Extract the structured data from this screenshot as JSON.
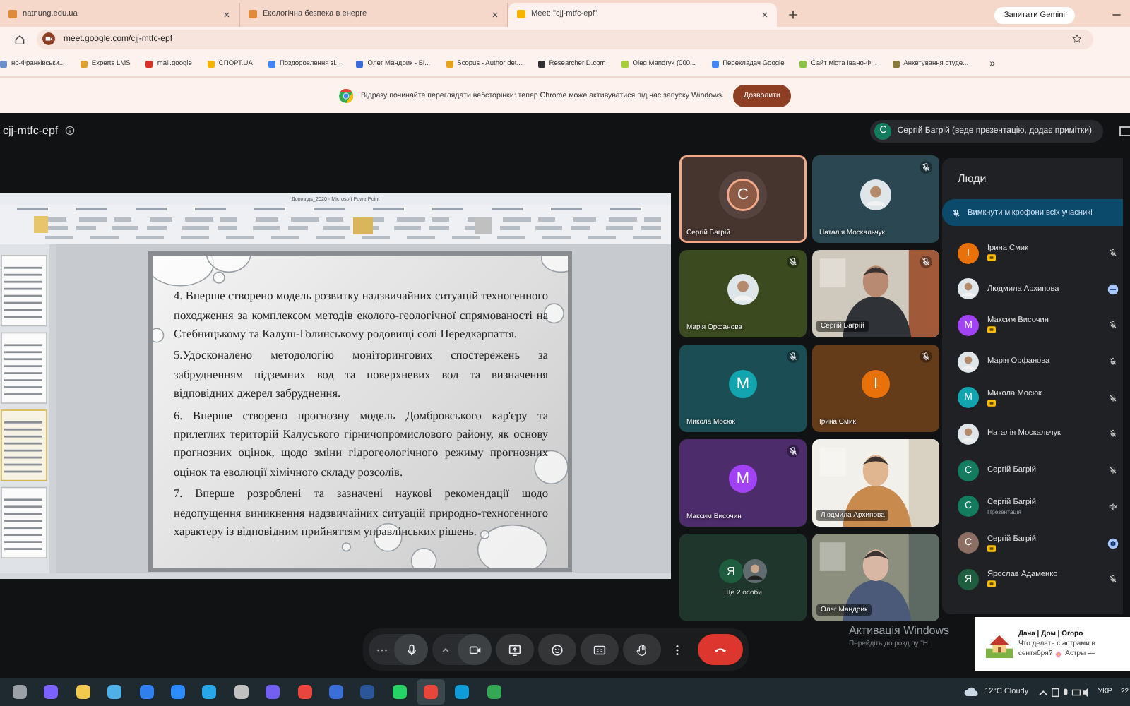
{
  "browser": {
    "tabs": [
      {
        "title": "natnung.edu.ua",
        "selected": false
      },
      {
        "title": "Екологічна безпека в енерге",
        "selected": false
      },
      {
        "title": "Meet: \"cjj-mtfc-epf\"",
        "selected": true
      }
    ],
    "gemini_button": "Запитати Gemini",
    "address": "meet.google.com/cjj-mtfc-epf",
    "bookmarks": [
      "но-Франківськи...",
      "Experts LMS",
      "mail.google",
      "СПОРТ.UA",
      "Поздоровлення зі...",
      "Олег Мандрик - Бі...",
      "Scopus - Author det...",
      "ResearcherID.com",
      "Oleg Mandryk (000...",
      "Перекладач Google",
      "Сайт міста Івано-Ф...",
      "Анкетування студе..."
    ],
    "bookmarks_more": "»",
    "infobar": {
      "message": "Відразу починайте переглядати вебсторінки: тепер Chrome може активуватися під час запуску Windows.",
      "button": "Дозволити"
    }
  },
  "meeting": {
    "code": "cjj-mtfc-epf",
    "presenter": {
      "letter": "С",
      "text": "Сергій Багрій (веде презентацію, додає примітки)"
    }
  },
  "presentation": {
    "window_title": "Доповідь_2020 - Microsoft PowerPoint",
    "paragraphs": [
      "4. Вперше створено модель розвитку надзвичайних ситуацій техногенного походження за комплексом методів еколого-геологічної спрямованості на Стебницькому та Калуш-Голинському родовищі солі Передкарпаття.",
      "5.Удосконалено методологію моніторингових спостережень за забрудненням підземних вод та поверхневих вод та визначення відповідних джерел забруднення.",
      "6. Вперше створено прогнозну модель Домбровського кар'єру та прилеглих територій Калуського гірничопромислового району, як основу прогнозних оцінок, щодо зміни гідрогеологічного режиму прогнозних оцінок та еволюції хімічного складу розсолів.",
      "7. Вперше розроблені та зазначені наукові рекомендації щодо недопущення виникнення надзвичайних ситуацій природно-техногенного характеру із відповідним прийняттям управлінських рішень."
    ]
  },
  "tiles": [
    {
      "name": "Сергій Багрій",
      "kind": "avatar",
      "letter": "С",
      "color": "#8d5a46",
      "speaking": true,
      "muted": false
    },
    {
      "name": "Наталія Москальчук",
      "color": "#2b4752",
      "speaking": false,
      "muted": true
    },
    {
      "name": "Марія Орфанова",
      "color": "#3b4a1f",
      "speaking": false,
      "muted": true
    },
    {
      "name": "Сергій Багрій",
      "kind": "video",
      "speaking": false,
      "muted": true
    },
    {
      "name": "Микола Мосюк",
      "kind": "avatar",
      "letter": "М",
      "color": "#12a4af",
      "speaking": false,
      "muted": true
    },
    {
      "name": "Ірина Смик",
      "kind": "avatar",
      "letter": "І",
      "color": "#e8710a",
      "speaking": false,
      "muted": true
    },
    {
      "name": "Максим Височин",
      "kind": "avatar",
      "letter": "М",
      "color": "#a142f4",
      "speaking": false,
      "muted": true
    },
    {
      "name": "Людмила Архипова",
      "kind": "video",
      "speaking": false,
      "muted": false
    },
    {
      "kind": "group",
      "label": "Ще 2 особи",
      "letter": "Я",
      "color": "#1e5e3f"
    },
    {
      "name": "Олег Мандрик",
      "kind": "video",
      "speaking": false,
      "muted": false
    }
  ],
  "people": {
    "title": "Люди",
    "mute_all": "Вимкнути мікрофони всіх учасникі",
    "items": [
      {
        "name": "Ірина Смик",
        "letter": "І",
        "color": "#e8710a",
        "badge": true,
        "kind": "muted"
      },
      {
        "name": "Людмила Архипова",
        "badge": false,
        "kind": "menu"
      },
      {
        "name": "Максим Височин",
        "letter": "М",
        "color": "#a142f4",
        "badge": true,
        "kind": "muted"
      },
      {
        "name": "Марія Орфанова",
        "badge": false,
        "kind": "muted"
      },
      {
        "name": "Микола Мосюк",
        "letter": "М",
        "color": "#12a4af",
        "badge": true,
        "kind": "muted"
      },
      {
        "name": "Наталія Москальчук",
        "badge": false,
        "kind": "muted"
      },
      {
        "name": "Сергій Багрій",
        "letter": "С",
        "color": "#137b5e",
        "badge": false,
        "kind": "muted"
      },
      {
        "name": "Сергій Багрій",
        "letter": "С",
        "color": "#137b5e",
        "badge": false,
        "subtitle": "Презентація",
        "kind": "presenting"
      },
      {
        "name": "Сергій Багрій",
        "letter": "С",
        "color": "#8d6e63",
        "badge": true,
        "kind": "speaking"
      },
      {
        "name": "Ярослав Адаменко",
        "letter": "Я",
        "color": "#1e5e3f",
        "badge": true,
        "kind": "muted"
      }
    ]
  },
  "windows": {
    "activation_title": "Активація Windows",
    "activation_hint": "Перейдіть до розділу \"Н",
    "notification": {
      "title": "Дача | Дом | Огоро",
      "line1": "Что делать с астрами в",
      "line2a": "сентября?",
      "line2b": "Астры —"
    },
    "weather": "12°C Cloudy",
    "language": "УКР",
    "clock": "22"
  }
}
